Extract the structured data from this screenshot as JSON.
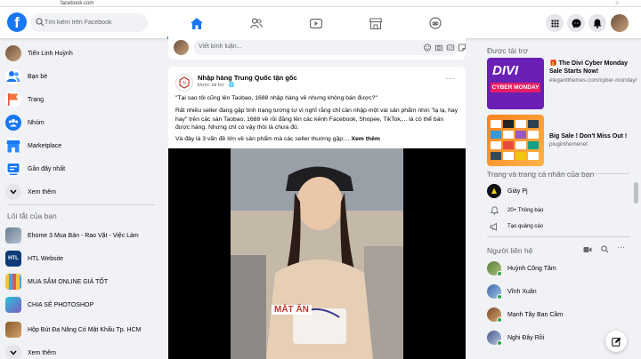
{
  "browser": {
    "url": "facebook.com"
  },
  "search": {
    "placeholder": "Tìm kiếm trên Facebook"
  },
  "leftnav": {
    "items": [
      {
        "label": "Tiến Linh Huỳnh",
        "icon": "profile-avatar"
      },
      {
        "label": "Bạn bè",
        "icon": "friends-icon"
      },
      {
        "label": "Trang",
        "icon": "pages-flag-icon"
      },
      {
        "label": "Nhóm",
        "icon": "groups-icon"
      },
      {
        "label": "Marketplace",
        "icon": "marketplace-icon"
      },
      {
        "label": "Gần đây nhất",
        "icon": "recent-icon"
      },
      {
        "label": "Xem thêm",
        "icon": "chevron-down-icon"
      }
    ],
    "shortcuts_title": "Lối tắt của bạn",
    "shortcuts": [
      {
        "label": "Ehome 3 Mua Bán - Rao Vặt - Việc Làm"
      },
      {
        "label": "HTL Website"
      },
      {
        "label": "MUA SẮM ONLINE GIÁ TỐT"
      },
      {
        "label": "CHIA SẺ PHOTOSHOP"
      },
      {
        "label": "Hộp Bút Đa Năng Có Mặt Khẩu Tp. HCM"
      },
      {
        "label": "Xem thêm"
      }
    ]
  },
  "comment_box": {
    "placeholder": "Viết bình luận..."
  },
  "post": {
    "author": "Nhập hàng Trung Quốc tận gốc",
    "meta": "Được tài trợ · ",
    "more": "···",
    "line1": "\"Tại sao tôi cũng lên Taobao, 1688 nhập hàng về nhưng không bán được?\"",
    "line2": "Rất nhiều seller đang gặp tình trạng tương tự vì nghĩ rằng chỉ cần nhập một vài sản phẩm nhìn \"lạ lạ, hay hay\" trên các sàn Taobao, 1688 về rồi đăng lên các kênh Facebook, Shopee, TikTok,... là có thể bán được hàng. Nhưng chỉ có vậy thôi là chưa đủ.",
    "line3": "Và đây là 3 vấn đề lớn về sản phẩm mà các seller thường gặp:...",
    "see_more": "Xem thêm",
    "video_caption": "MẮT ĂN"
  },
  "right": {
    "sponsored_title": "Được tài trợ",
    "ads": [
      {
        "title": "🎁 The Divi Cyber Monday Sale Starts Now!",
        "domain": "elegantthemes.com/cyber-monday/",
        "thumb_label": "DIVI",
        "thumb_sub": "CYBER MONDAY"
      },
      {
        "title": "Big Sale ! Don't Miss Out !",
        "domain": "pluginthemenet"
      }
    ],
    "pages_title": "Trang và trang cá nhân của bạn",
    "page_name": "Giày Pj",
    "page_notifications": "20+ Thông báo",
    "page_create_ad": "Tạo quảng cáo",
    "contacts_title": "Người liên hệ",
    "contacts": [
      {
        "name": "Huỳnh Công Tâm"
      },
      {
        "name": "Vĩnh Xuân"
      },
      {
        "name": "Mạnh Tây Ban Cầm"
      },
      {
        "name": "Nghi Đây Rồi"
      }
    ]
  },
  "colors": {
    "brand": "#1877f2",
    "online": "#31a24c",
    "bg": "#f0f2f5"
  }
}
